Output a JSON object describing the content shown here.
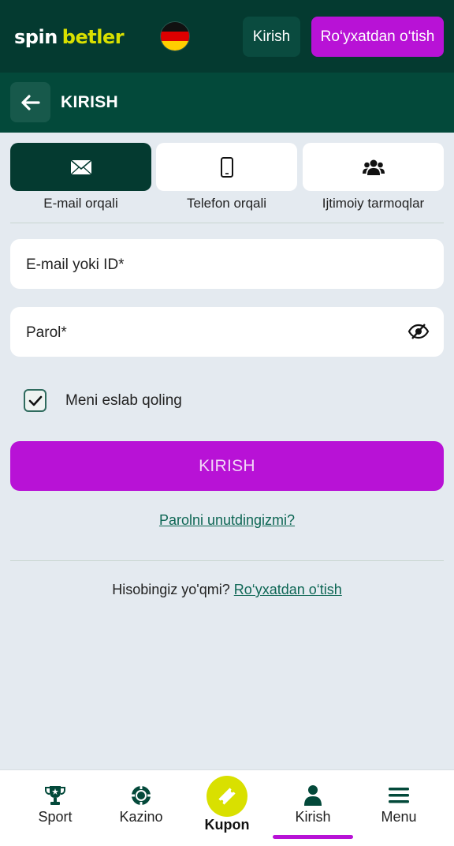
{
  "header": {
    "logo_part1": "spin",
    "logo_part2": "betler",
    "login_label": "Kirish",
    "register_label": "Ro‘yxatdan o‘tish"
  },
  "subheader": {
    "title": "KIRISH"
  },
  "tabs": [
    {
      "label": "E-mail orqali",
      "icon": "envelope-icon",
      "active": true
    },
    {
      "label": "Telefon orqali",
      "icon": "phone-icon",
      "active": false
    },
    {
      "label": "Ijtimoiy tarmoqlar",
      "icon": "users-icon",
      "active": false
    }
  ],
  "form": {
    "email_placeholder": "E-mail yoki ID*",
    "password_placeholder": "Parol*",
    "remember_label": "Meni eslab qoling",
    "remember_checked": true,
    "submit_label": "KIRISH",
    "forgot_label": "Parolni unutdingizmi?",
    "no_account_text": "Hisobingiz yo'qmi? ",
    "register_link": "Ro‘yxatdan o‘tish"
  },
  "bottom_nav": {
    "items": [
      {
        "label": "Sport",
        "icon": "trophy-icon"
      },
      {
        "label": "Kazino",
        "icon": "casino-chip-icon"
      },
      {
        "label": "Kupon",
        "icon": "ticket-icon"
      },
      {
        "label": "Kirish",
        "icon": "user-icon",
        "active": true
      },
      {
        "label": "Menu",
        "icon": "hamburger-icon"
      }
    ]
  },
  "colors": {
    "header_bg": "#043a30",
    "subheader_bg": "#03493a",
    "accent_purple": "#b812d6",
    "accent_yellow": "#d9e000",
    "link_green": "#0d6654",
    "page_bg": "#e4eaf0"
  }
}
